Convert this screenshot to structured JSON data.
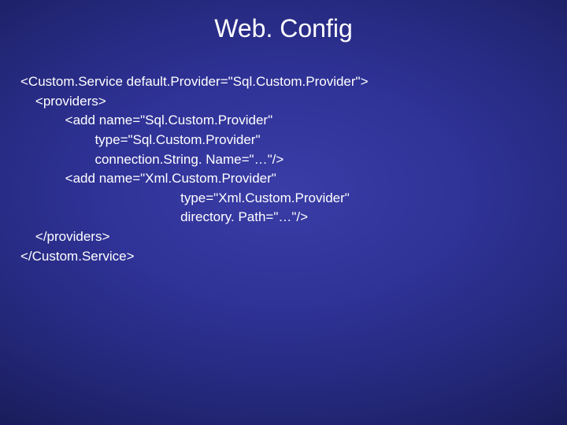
{
  "title": "Web. Config",
  "code": {
    "l1": "<Custom.Service default.Provider=\"Sql.Custom.Provider\">",
    "l2": "    <providers>",
    "l3": "            <add name=\"Sql.Custom.Provider\"",
    "l4": "                    type=\"Sql.Custom.Provider\"",
    "l5": "                    connection.String. Name=\"…\"/>",
    "l6": "            <add name=\"Xml.Custom.Provider\"",
    "l7": "                                           type=\"Xml.Custom.Provider\"",
    "l8": "                                           directory. Path=\"…\"/>",
    "l9": "    </providers>",
    "l10": "</Custom.Service>"
  }
}
